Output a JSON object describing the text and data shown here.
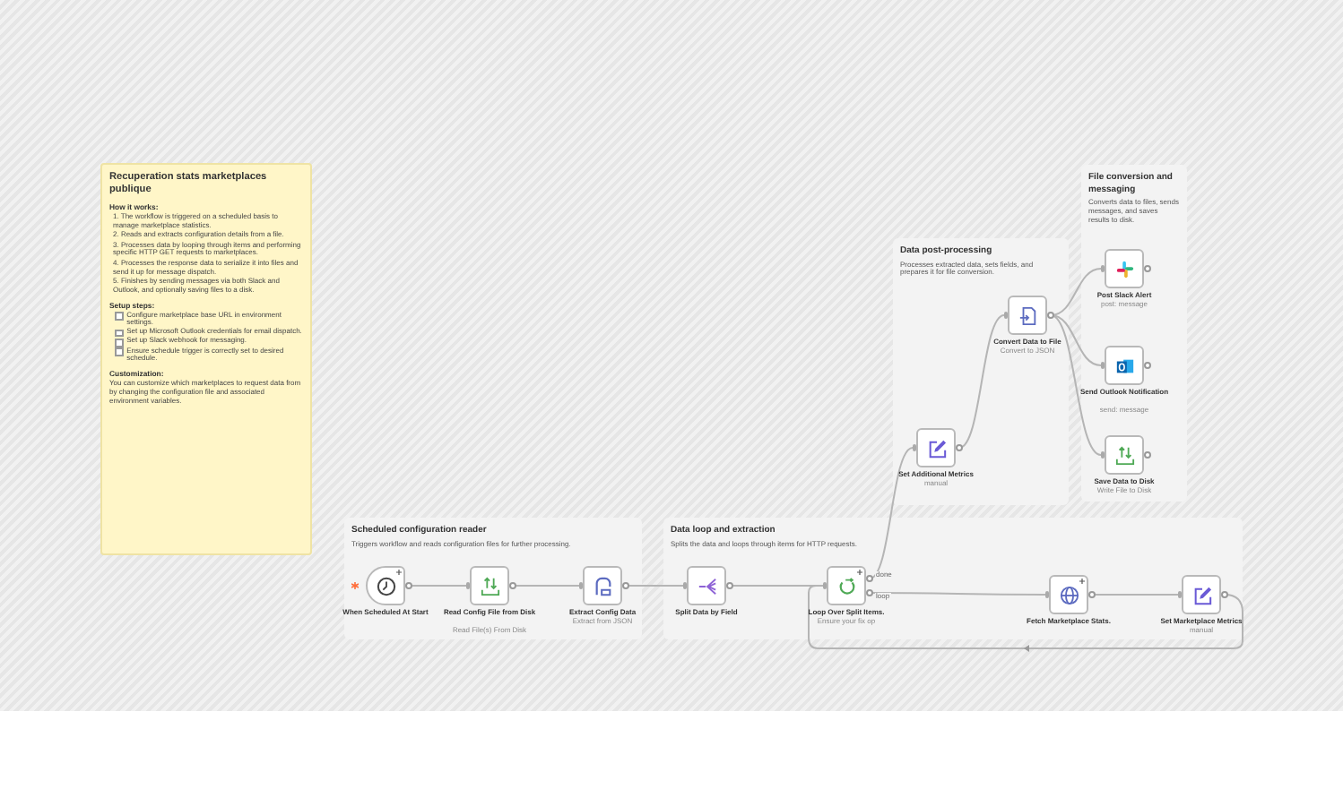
{
  "sticky_note": {
    "title": "Recuperation stats marketplaces publique",
    "how_it_works": {
      "heading": "How it works:",
      "steps": [
        "1. The workflow is triggered on a scheduled basis to manage marketplace statistics.",
        "2. Reads and extracts configuration details from a file.",
        "3. Processes data by looping through items and performing specific HTTP GET requests to marketplaces.",
        "4. Processes the response data to serialize it into files and send it up for message dispatch.",
        "5. Finishes by sending messages via both Slack and Outlook, and optionally saving files to a disk."
      ]
    },
    "setup": {
      "heading": "Setup steps:",
      "items": [
        {
          "text": "Configure marketplace base URL in environment settings.",
          "checked": false
        },
        {
          "text": "Set up Microsoft Outlook credentials for email dispatch.",
          "checked": false
        },
        {
          "text": "Set up Slack webhook for messaging.",
          "checked": false
        },
        {
          "text": "Ensure schedule trigger is correctly set to desired schedule.",
          "checked": false
        }
      ]
    },
    "customization": {
      "heading": "Customization:",
      "text": "You can customize which marketplaces to request data from by changing the configuration file and associated environment variables."
    }
  },
  "groups": [
    {
      "title": "Data post-processing",
      "description": "Processes extracted data, sets fields, and prepares it for file conversion."
    },
    {
      "title": "File conversion and messaging",
      "description": "Converts data to files, sends messages, and saves results to disk."
    },
    {
      "title": "Scheduled configuration reader",
      "description": "Triggers workflow and reads configuration files for further processing."
    },
    {
      "title": "Data loop and extraction",
      "description": "Splits the data and loops through items for HTTP requests."
    }
  ],
  "nodes": [
    {
      "kind": "schedule",
      "label": "When Scheduled At Start",
      "trigger": true,
      "add_button": true
    },
    {
      "kind": "readfile",
      "label": "Read Config File from Disk",
      "subtitle": "Read File(s) From Disk"
    },
    {
      "kind": "json",
      "label": "Extract Config Data",
      "subtitle": "Extract from JSON"
    },
    {
      "kind": "split",
      "label": "Split Data by Field"
    },
    {
      "kind": "loop",
      "label": "Loop Over Split Items.",
      "subtitle": "Ensure your fix op",
      "add_button": true,
      "outputs": [
        "done",
        "loop"
      ]
    },
    {
      "kind": "http",
      "label": "Fetch Marketplace Stats.",
      "add_button": true
    },
    {
      "kind": "set",
      "label": "Set Marketplace Metrics",
      "subtitle": "manual"
    },
    {
      "kind": "set",
      "label": "Set Additional Metrics",
      "subtitle": "manual"
    },
    {
      "kind": "convert",
      "label": "Convert Data to File",
      "subtitle": "Convert to JSON"
    },
    {
      "kind": "slack",
      "label": "Post Slack Alert",
      "subtitle": "post: message"
    },
    {
      "kind": "outlook",
      "label": "Send Outlook Notification",
      "subtitle": "send: message"
    },
    {
      "kind": "writefile",
      "label": "Save Data to Disk",
      "subtitle": "Write File to Disk"
    }
  ]
}
